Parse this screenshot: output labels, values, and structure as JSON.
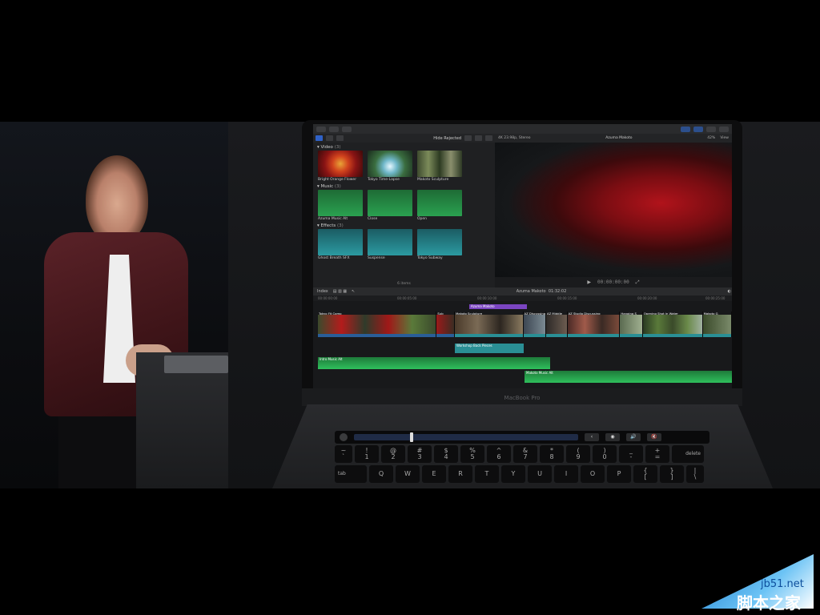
{
  "laptop_label": "MacBook Pro",
  "fcp": {
    "browser": {
      "filter_label": "Hide Rejected",
      "sections": [
        {
          "name": "Video",
          "count": "(3)",
          "clips": [
            "Bright Orange Flower",
            "Tokyo Time-Lapse",
            "Makoto Sculpture"
          ]
        },
        {
          "name": "Music",
          "count": "(3)",
          "clips": [
            "Azuma Music Alt",
            "Close",
            "Open"
          ]
        },
        {
          "name": "Effects",
          "count": "(3)",
          "clips": [
            "Ghost Breath SFX",
            "Suspense",
            "Tokyo Subway"
          ]
        }
      ],
      "items_count": "6 items"
    },
    "viewer": {
      "format": "4K 23.98p, Stereo",
      "title": "Azuma Makoto",
      "zoom": "42%",
      "view_label": "View"
    },
    "timeline_bar": {
      "index_label": "Index",
      "project_name": "Azuma Makoto",
      "duration": "01:32:02"
    },
    "ruler": [
      "00:00:00:00",
      "00:00:05:00",
      "00:00:10:00",
      "00:00:15:00",
      "00:00:20:00",
      "00:00:25:00"
    ],
    "connected_title": "Azuma Makoto",
    "primary_clips": [
      "Tokyo Fit Comp",
      "Sub",
      "Makoto Sculpture",
      "AZ Discussing",
      "AZ Middle",
      "AZ Studio Discussing",
      "Hanging S",
      "Opening Shot in Water",
      "Makoto G"
    ],
    "broll_clip": "Workshop Back Pieces",
    "music_clips": [
      "Intro Music Alt",
      "Makoto Music Alt"
    ]
  },
  "touchbar": {
    "items": [
      "‹",
      "◉",
      "🔊",
      "🔇"
    ]
  },
  "keyboard": {
    "row1": [
      "~\n`",
      "!\n1",
      "@\n2",
      "#\n3",
      "$\n4",
      "%\n5",
      "^\n6",
      "&\n7",
      "*\n8",
      "(\n9",
      ")\n0",
      "_\n-",
      "+\n=",
      "delete"
    ],
    "row2": [
      "tab",
      "Q",
      "W",
      "E",
      "R",
      "T",
      "Y",
      "U",
      "I",
      "O",
      "P",
      "{\n[",
      "}\n]",
      "|\n\\"
    ]
  },
  "watermark": {
    "site": "jb51.net",
    "name": "脚本之家"
  },
  "colors": {
    "fcp_blue": "#2f61c7",
    "connected_purple": "#7b45c2",
    "primary_blue": "#2a5e97",
    "music_green": "#2fbf5c",
    "broll_teal": "#2a8f95"
  }
}
